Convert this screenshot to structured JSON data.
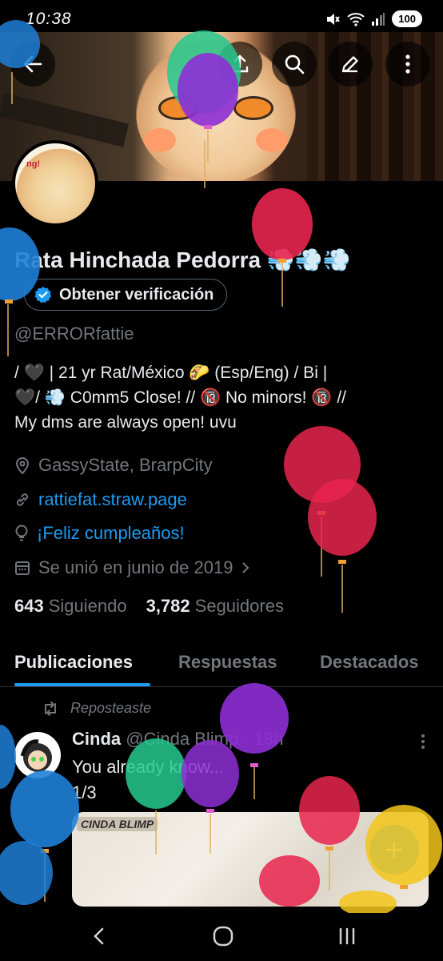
{
  "status_bar": {
    "time": "10:38",
    "battery": "100"
  },
  "profile": {
    "display_name": "Rata Hinchada Pedorra 💨💨💨",
    "verify_label": "Obtener verificación",
    "handle": "@ERRORfattie",
    "bio": "/ 🖤 | 21 yr Rat/México 🌮 (Esp/Eng) / Bi |\n🖤/ 💨 C0mm5 Close! // 🔞 No minors! 🔞 //\nMy dms are always open! uvu",
    "location": "GassyState, BrarpCity",
    "website": "rattiefat.straw.page",
    "birthday": "¡Feliz cumpleaños!",
    "joined": "Se unió en junio de 2019",
    "following_count": "643",
    "following_label": "Siguiendo",
    "followers_count": "3,782",
    "followers_label": "Seguidores"
  },
  "tabs": [
    {
      "label": "Publicaciones",
      "active": true
    },
    {
      "label": "Respuestas",
      "active": false
    },
    {
      "label": "Destacados",
      "active": false
    }
  ],
  "post": {
    "repost_label": "Reposteaste",
    "author_name": "Cinda",
    "author_handle": "@Cinda Blimp",
    "time": "18h",
    "text": "You already know...\n1/3",
    "media_logo": "CINDA BLIMP"
  },
  "accent_color": "#1d9bf0",
  "icons": [
    "back-arrow-icon",
    "share-icon",
    "search-icon",
    "edit-icon",
    "more-vertical-icon",
    "verified-badge-icon",
    "location-pin-icon",
    "link-icon",
    "balloon-bulb-icon",
    "calendar-icon",
    "chevron-right-icon",
    "repost-icon",
    "plus-icon",
    "nav-back-icon",
    "nav-home-icon",
    "nav-recents-icon"
  ]
}
